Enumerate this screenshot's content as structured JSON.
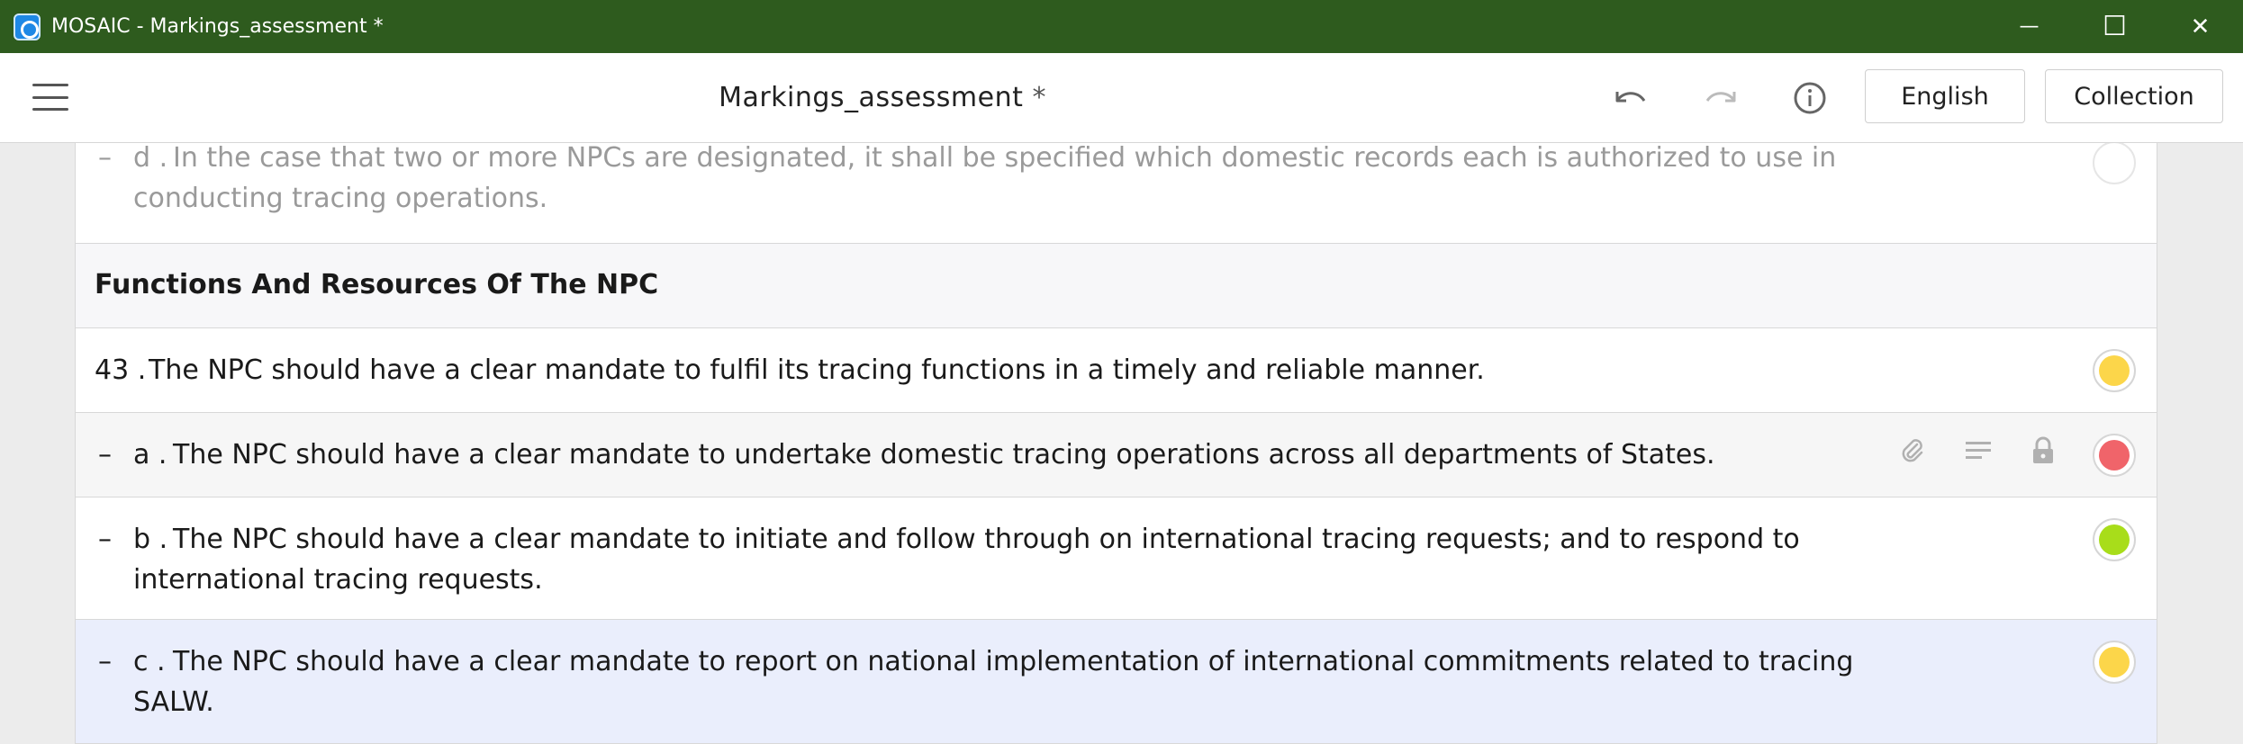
{
  "window": {
    "title": "MOSAIC - Markings_assessment *",
    "minimize_glyph": "—",
    "maximize_glyph": "☐",
    "close_glyph": "✕"
  },
  "toolbar": {
    "doc_title": "Markings_assessment",
    "modified_marker": "*",
    "language_button": "English",
    "collection_button": "Collection"
  },
  "rows": [
    {
      "number": "d .",
      "text_line1": "In the case that two or more NPCs are designated, it shall be specified which domestic records each is authorized to use in",
      "text_line2": "conducting tracing operations.",
      "rating_color": "#ffffff",
      "state": "faded"
    },
    {
      "section_title": "Functions And Resources Of The NPC"
    },
    {
      "number": "43 .",
      "text_line1": "The NPC should have a clear mandate to fulfil its tracing functions in a timely and reliable manner.",
      "rating_color": "#fcd64a"
    },
    {
      "number": "a .",
      "text_line1": "The NPC should have a clear mandate to undertake domestic tracing operations across all departments of States.",
      "rating_color": "#f0646a",
      "state": "hovered"
    },
    {
      "number": "b .",
      "text_line1": "The NPC should have a clear mandate to initiate and follow through on international tracing requests; and to respond to",
      "text_line2": "international tracing requests.",
      "rating_color": "#a8dd1a"
    },
    {
      "number": "c .",
      "text_line1": "The NPC should have a clear mandate to report on national implementation of international commitments related to tracing",
      "text_line2": "SALW.",
      "rating_color": "#fcd64a",
      "state": "selected"
    }
  ],
  "colors": {
    "titlebar": "#2e5b1e",
    "selected_row": "#eaeefc",
    "hovered_row": "#f6f6f6"
  },
  "icons": {
    "attachment": "paperclip-icon",
    "notes": "notes-icon",
    "lock": "lock-icon",
    "undo": "undo-icon",
    "redo": "redo-icon",
    "info": "info-icon",
    "menu": "hamburger-icon"
  }
}
